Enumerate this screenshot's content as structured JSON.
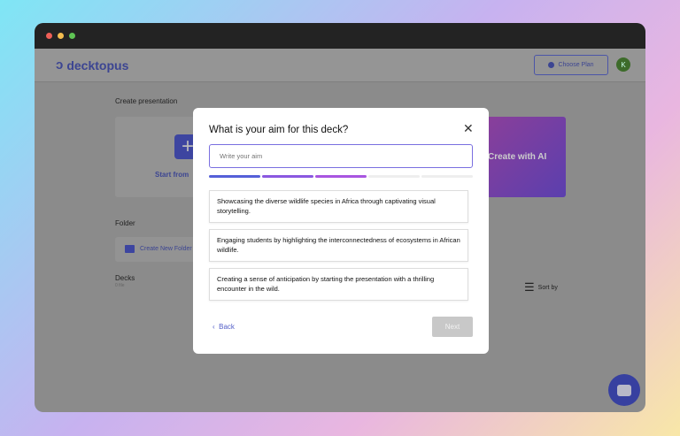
{
  "window": {
    "dots": [
      "#ee5f57",
      "#f4bd4f",
      "#5fc454"
    ]
  },
  "header": {
    "logo": "decktopus",
    "choose_plan": "Choose Plan",
    "avatar_initial": "K"
  },
  "main": {
    "create_presentation": "Create presentation",
    "start_from": "Start from",
    "create_ai": "Create with AI",
    "folder": "Folder",
    "create_folder": "Create New Folder",
    "decks": "Decks",
    "decks_count": "0 file",
    "sort_by": "Sort by"
  },
  "modal": {
    "title": "What is your aim for this deck?",
    "input_placeholder": "Write your aim",
    "progress": {
      "step": 3,
      "total": 5
    },
    "options": [
      "Showcasing the diverse wildlife species in Africa through captivating visual storytelling.",
      "Engaging students by highlighting the interconnectedness of ecosystems in African wildlife.",
      "Creating a sense of anticipation by starting the presentation with a thrilling encounter in the wild."
    ],
    "back": "Back",
    "next": "Next"
  },
  "colors": {
    "accent": "#5560c8",
    "ai_gradient": [
      "#5b3fae",
      "#a04bb8"
    ]
  }
}
